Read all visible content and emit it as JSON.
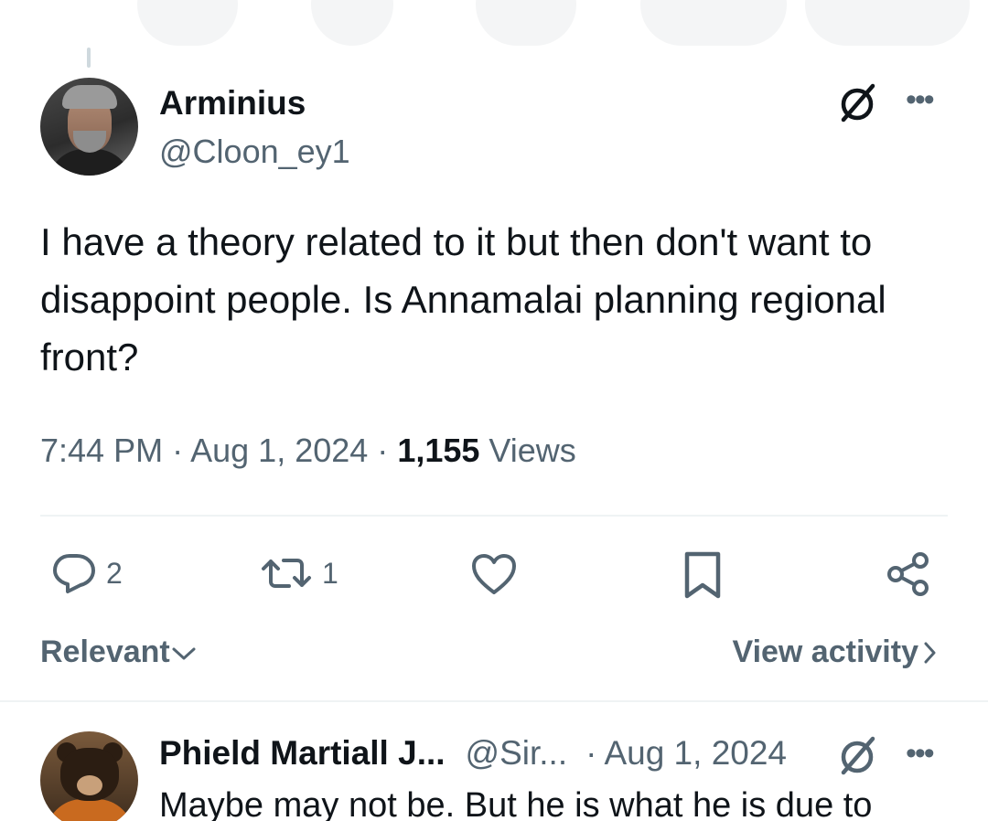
{
  "tweet": {
    "author": {
      "display_name": "Arminius",
      "handle": "@Cloon_ey1",
      "avatar_icon": "avatar-man-gray-beard"
    },
    "text": "I have a theory related to it but then don't want to disappoint people. Is Annamalai planning regional front?",
    "meta": {
      "time": "7:44 PM",
      "separator": "·",
      "date": "Aug 1, 2024",
      "views_count": "1,155",
      "views_label": "Views"
    },
    "actions": {
      "reply_count": "2",
      "retweet_count": "1",
      "like_icon": "heart-icon",
      "bookmark_icon": "bookmark-icon",
      "share_icon": "share-icon"
    }
  },
  "sort": {
    "label": "Relevant",
    "view_activity_label": "View activity"
  },
  "reply": {
    "display_name": "Phield Martiall J...",
    "handle": "@Sir...",
    "separator": "·",
    "date": "Aug 1, 2024",
    "text": "Maybe may not be. But he is what he is due to",
    "avatar_icon": "avatar-bear-orange-robe"
  },
  "colors": {
    "text_primary": "#0f1419",
    "text_secondary": "#536471",
    "divider": "#eff3f4"
  }
}
